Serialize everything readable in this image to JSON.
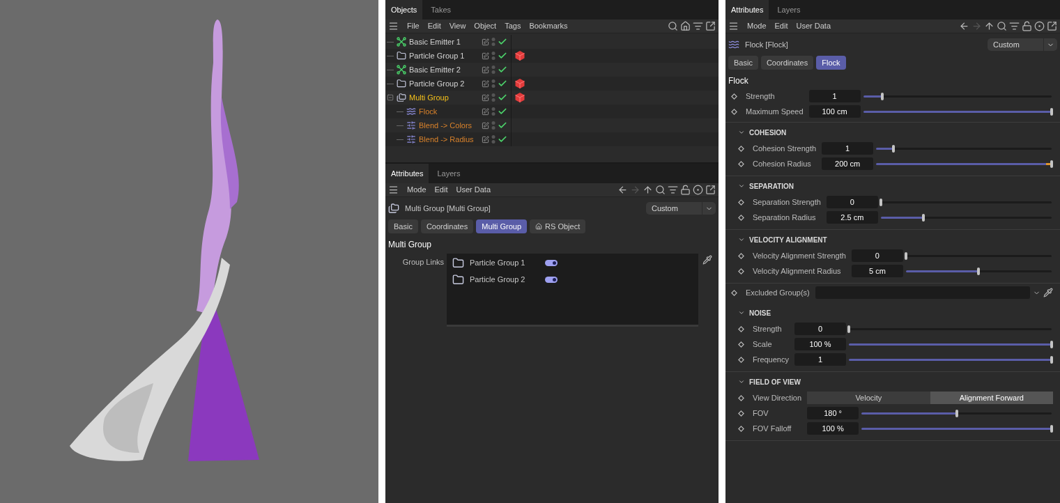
{
  "objects_panel": {
    "tabs": [
      {
        "label": "Objects",
        "selected": true
      },
      {
        "label": "Takes",
        "selected": false
      }
    ],
    "menu": [
      "File",
      "Edit",
      "View",
      "Object",
      "Tags",
      "Bookmarks"
    ],
    "tree": [
      {
        "kind": "emitter",
        "name": "Basic Emitter 1",
        "color": "#d4d4d4",
        "enabled": true,
        "material_tag": false
      },
      {
        "kind": "group",
        "name": "Particle Group 1",
        "color": "#d4d4d4",
        "enabled": true,
        "material_tag": true
      },
      {
        "kind": "emitter",
        "name": "Basic Emitter 2",
        "color": "#d4d4d4",
        "enabled": true,
        "material_tag": false
      },
      {
        "kind": "group",
        "name": "Particle Group 2",
        "color": "#d4d4d4",
        "enabled": true,
        "material_tag": true
      },
      {
        "kind": "multigroup",
        "name": "Multi Group",
        "color": "#f5c11a",
        "enabled": true,
        "material_tag": true,
        "expanded": true,
        "children": [
          {
            "kind": "flock",
            "name": "Flock",
            "color": "#d9822b",
            "enabled": true,
            "material_tag": false
          },
          {
            "kind": "blend",
            "name": "Blend -> Colors",
            "color": "#d9822b",
            "enabled": true,
            "material_tag": false
          },
          {
            "kind": "blend",
            "name": "Blend -> Radius",
            "color": "#d9822b",
            "enabled": true,
            "material_tag": false
          }
        ]
      }
    ]
  },
  "multi_group_attributes": {
    "tabs": [
      {
        "label": "Attributes",
        "selected": true
      },
      {
        "label": "Layers",
        "selected": false
      }
    ],
    "menu": [
      "Mode",
      "Edit",
      "User Data"
    ],
    "object_title": "Multi Group [Multi Group]",
    "mode": "Custom",
    "subtabs": [
      {
        "kind": "plain",
        "label": "Basic",
        "selected": false
      },
      {
        "kind": "plain",
        "label": "Coordinates",
        "selected": false
      },
      {
        "kind": "plain",
        "label": "Multi Group",
        "selected": true
      },
      {
        "kind": "rs",
        "label": "RS Object",
        "selected": false
      }
    ],
    "section_title": "Multi Group",
    "field_label": "Group Links",
    "links": [
      {
        "name": "Particle Group 1",
        "on": true
      },
      {
        "name": "Particle Group 2",
        "on": true
      }
    ]
  },
  "flock_attributes": {
    "tabs": [
      {
        "label": "Attributes",
        "selected": true
      },
      {
        "label": "Layers",
        "selected": false
      }
    ],
    "menu": [
      "Mode",
      "Edit",
      "User Data"
    ],
    "object_title": "Flock [Flock]",
    "mode": "Custom",
    "subtabs": [
      {
        "kind": "plain",
        "label": "Basic",
        "selected": false
      },
      {
        "kind": "plain",
        "label": "Coordinates",
        "selected": false
      },
      {
        "kind": "plain",
        "label": "Flock",
        "selected": true
      }
    ],
    "section_title": "Flock",
    "groups": [
      {
        "kind": "plain",
        "params": [
          {
            "kind": "slider",
            "label": "Strength",
            "value": "1",
            "level": 0.1
          },
          {
            "kind": "slider",
            "label": "Maximum Speed",
            "value": "100 cm",
            "level": 1
          }
        ]
      },
      {
        "kind": "collapsible",
        "title": "COHESION",
        "expanded": true,
        "params": [
          {
            "kind": "slider",
            "label": "Cohesion Strength",
            "value": "1",
            "level": 0.1
          },
          {
            "kind": "slider",
            "label": "Cohesion Radius",
            "value": "200 cm",
            "level": 1,
            "overflow": true
          }
        ]
      },
      {
        "kind": "collapsible",
        "title": "SEPARATION",
        "expanded": true,
        "params": [
          {
            "kind": "slider",
            "label": "Separation Strength",
            "value": "0",
            "level": 0
          },
          {
            "kind": "slider",
            "label": "Separation Radius",
            "value": "2.5 cm",
            "level": 0.25
          }
        ]
      },
      {
        "kind": "collapsible",
        "title": "VELOCITY ALIGNMENT",
        "expanded": true,
        "params": [
          {
            "kind": "slider",
            "label": "Velocity Alignment Strength",
            "value": "0",
            "level": 0
          },
          {
            "kind": "slider",
            "label": "Velocity Alignment Radius",
            "value": "5 cm",
            "level": 0.5
          }
        ]
      },
      {
        "kind": "plain",
        "params": [
          {
            "kind": "link",
            "label": "Excluded Group(s)"
          }
        ]
      },
      {
        "kind": "collapsible",
        "title": "NOISE",
        "expanded": true,
        "params": [
          {
            "kind": "slider",
            "label": "Strength",
            "value": "0",
            "level": 0
          },
          {
            "kind": "slider",
            "label": "Scale",
            "value": "100 %",
            "level": 1
          },
          {
            "kind": "slider",
            "label": "Frequency",
            "value": "1",
            "level": 1
          }
        ]
      },
      {
        "kind": "collapsible",
        "title": "FIELD OF VIEW",
        "expanded": true,
        "params": [
          {
            "kind": "segmented",
            "label": "View Direction",
            "options": [
              {
                "label": "Velocity",
                "selected": false
              },
              {
                "label": "Alignment Forward",
                "selected": true
              }
            ]
          },
          {
            "kind": "slider",
            "label": "FOV",
            "value": "180 °",
            "level": 0.5
          },
          {
            "kind": "slider",
            "label": "FOV Falloff",
            "value": "100 %",
            "level": 1
          }
        ]
      }
    ]
  }
}
